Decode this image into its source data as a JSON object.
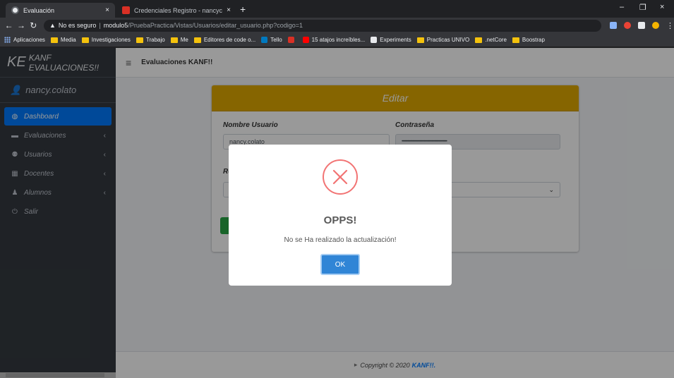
{
  "browser": {
    "tabs": [
      {
        "title": "Evaluación",
        "close": "×"
      },
      {
        "title": "Credenciales Registro - nancycol",
        "close": "×"
      }
    ],
    "new_tab": "+",
    "window_controls": {
      "minimize": "–",
      "restore": "❐",
      "close": "×"
    },
    "address": {
      "security": "No es seguro",
      "separator": "|",
      "host": "modulo5",
      "path": "/PruebaPractica/Vistas/Usuarios/editar_usuario.php?codigo=1"
    },
    "bookmarks": [
      {
        "label": "Aplicaciones",
        "type": "apps"
      },
      {
        "label": "Media",
        "type": "folder"
      },
      {
        "label": "Investigaciones",
        "type": "folder"
      },
      {
        "label": "Trabajo",
        "type": "folder"
      },
      {
        "label": "Me",
        "type": "folder"
      },
      {
        "label": "Editores de code o...",
        "type": "folder"
      },
      {
        "label": "Tello",
        "type": "fav",
        "color": "#0079bf"
      },
      {
        "label": "",
        "type": "fav",
        "color": "#d93025"
      },
      {
        "label": "15 atajos increíbles...",
        "type": "fav",
        "color": "#ff0000"
      },
      {
        "label": "Experiments",
        "type": "fav",
        "color": "#e8eaed"
      },
      {
        "label": "Practicas UNIVO",
        "type": "folder"
      },
      {
        "label": ".netCore",
        "type": "folder"
      },
      {
        "label": "Boostrap",
        "type": "folder"
      }
    ]
  },
  "sidebar": {
    "brand_short": "KE",
    "brand_name": "KANF EVALUACIONES!!",
    "user": "nancy.colato",
    "items": [
      {
        "label": "Dashboard",
        "icon": "dashboard-icon",
        "active": true,
        "chevron": ""
      },
      {
        "label": "Evaluaciones",
        "icon": "folder-icon",
        "active": false,
        "chevron": "‹"
      },
      {
        "label": "Usuarios",
        "icon": "users-icon",
        "active": false,
        "chevron": "‹"
      },
      {
        "label": "Docentes",
        "icon": "teacher-icon",
        "active": false,
        "chevron": "‹"
      },
      {
        "label": "Alumnos",
        "icon": "student-icon",
        "active": false,
        "chevron": "‹"
      },
      {
        "label": "Salir",
        "icon": "power-icon",
        "active": false,
        "chevron": ""
      }
    ]
  },
  "topnav": {
    "title": "Evaluaciones KANF!!"
  },
  "card": {
    "header": "Editar",
    "fields": {
      "username_label": "Nombre Usuario",
      "username_value": "nancy.colato",
      "password_label": "Contraseña",
      "password_value": "••••••••••••••••••••••••••••••••••••••••••••••••••••••••••",
      "role_label_partial": "Ro"
    }
  },
  "footer": {
    "text": "Copyright © 2020",
    "brand": "KANF!!."
  },
  "modal": {
    "title": "OPPS!",
    "message": "No se Ha realizado la actualización!",
    "button": "OK",
    "accent": "#f27474",
    "button_color": "#3085d6"
  }
}
